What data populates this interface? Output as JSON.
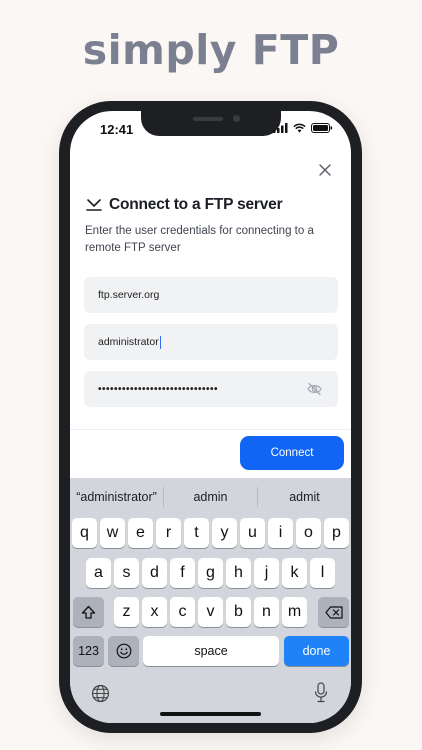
{
  "headline": "simply FTP",
  "status_bar": {
    "time": "12:41"
  },
  "dialog": {
    "title": "Connect to a FTP server",
    "description": "Enter the user credentials for connecting to a remote FTP server",
    "host_value": "ftp.server.org",
    "username_value": "administrator",
    "password_value": "••••••••••••••••••••••••••••••",
    "connect_label": "Connect"
  },
  "keyboard": {
    "suggestions": [
      "“administrator”",
      "admin",
      "admit"
    ],
    "row1": [
      "q",
      "w",
      "e",
      "r",
      "t",
      "y",
      "u",
      "i",
      "o",
      "p"
    ],
    "row2": [
      "a",
      "s",
      "d",
      "f",
      "g",
      "h",
      "j",
      "k",
      "l"
    ],
    "row3": [
      "z",
      "x",
      "c",
      "v",
      "b",
      "n",
      "m"
    ],
    "numbers_label": "123",
    "space_label": "space",
    "done_label": "done"
  },
  "colors": {
    "accent": "#1065f5",
    "done_key": "#1f82f7",
    "headline": "#7b8090"
  }
}
